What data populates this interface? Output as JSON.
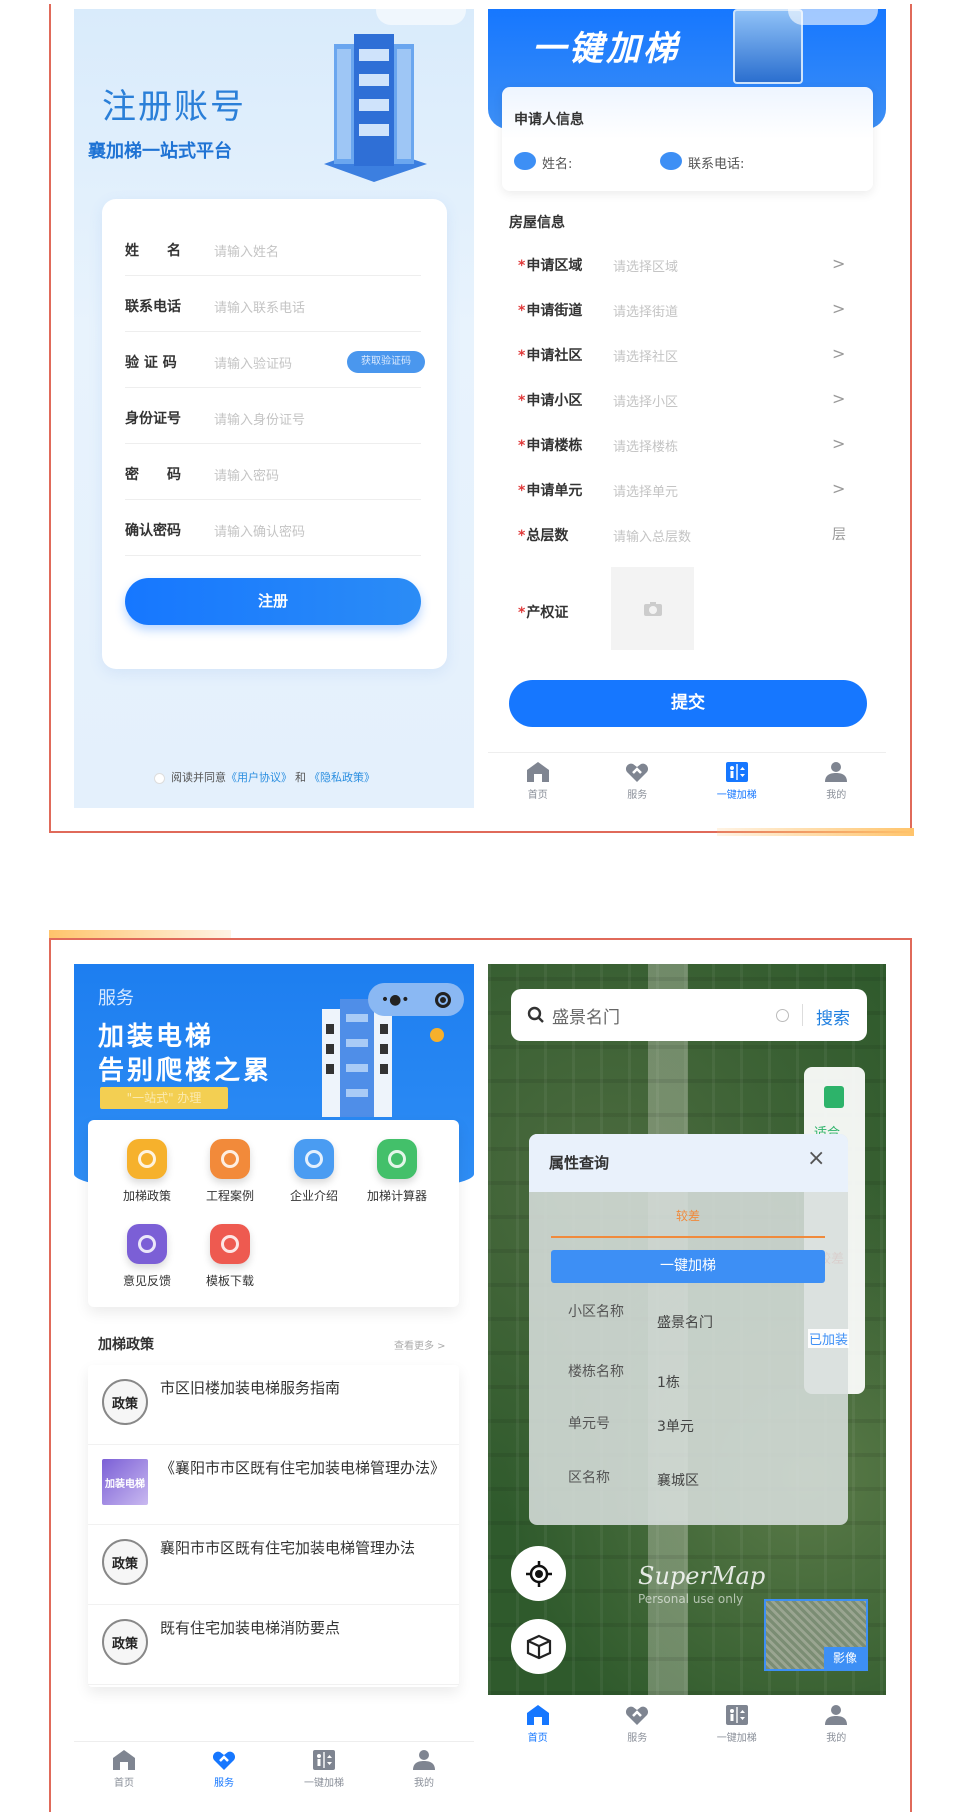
{
  "colors": {
    "accent": "#1677ff",
    "frame": "#e06a5a",
    "orange": "#f08a3c",
    "required": "#e03a3a"
  },
  "register": {
    "title": "注册账号",
    "subtitle": "襄加梯一站式平台",
    "fields": [
      {
        "label": "姓　　名",
        "placeholder": "请输入姓名"
      },
      {
        "label": "联系电话",
        "placeholder": "请输入联系电话"
      },
      {
        "label": "验 证 码",
        "placeholder": "请输入验证码"
      },
      {
        "label": "身份证号",
        "placeholder": "请输入身份证号"
      },
      {
        "label": "密　　码",
        "placeholder": "请输入密码"
      },
      {
        "label": "确认密码",
        "placeholder": "请输入确认密码"
      }
    ],
    "get_code": "获取验证码",
    "submit": "注册",
    "agree_prefix": "阅读并同意",
    "user_agreement": "《用户协议》",
    "and": "和",
    "privacy": "《隐私政策》"
  },
  "apply": {
    "title": "一键加梯",
    "applicant_heading": "申请人信息",
    "name_label": "姓名:",
    "phone_label": "联系电话:",
    "house_heading": "房屋信息",
    "rows": [
      {
        "label": "申请区域",
        "placeholder": "请选择区域",
        "suffix": ">"
      },
      {
        "label": "申请街道",
        "placeholder": "请选择街道",
        "suffix": ">"
      },
      {
        "label": "申请社区",
        "placeholder": "请选择社区",
        "suffix": ">"
      },
      {
        "label": "申请小区",
        "placeholder": "请选择小区",
        "suffix": ">"
      },
      {
        "label": "申请楼栋",
        "placeholder": "请选择楼栋",
        "suffix": ">"
      },
      {
        "label": "申请单元",
        "placeholder": "请选择单元",
        "suffix": ">"
      },
      {
        "label": "总层数",
        "placeholder": "请输入总层数",
        "suffix": "层"
      }
    ],
    "certificate_label": "产权证",
    "submit": "提交",
    "active_tab": 2
  },
  "nav": [
    "首页",
    "服务",
    "一键加梯",
    "我的"
  ],
  "service": {
    "tag": "服务",
    "headline1": "加装电梯",
    "headline2": "告别爬楼之累",
    "badge": "\"一站式\" 办理",
    "grid": [
      {
        "label": "加梯政策",
        "color": "#f6b12c"
      },
      {
        "label": "工程案例",
        "color": "#f28a3a"
      },
      {
        "label": "企业介绍",
        "color": "#4a9cf2"
      },
      {
        "label": "加梯计算器",
        "color": "#43c06a"
      },
      {
        "label": "意见反馈",
        "color": "#7b5fd6"
      },
      {
        "label": "模板下载",
        "color": "#ee5a50"
      }
    ],
    "policy_heading": "加梯政策",
    "more": "查看更多 >",
    "policies": [
      {
        "title": "市区旧楼加装电梯服务指南",
        "thumb": "政策"
      },
      {
        "title": "《襄阳市市区既有住宅加装电梯管理办法》",
        "thumb": "加装电梯"
      },
      {
        "title": "襄阳市市区既有住宅加装电梯管理办法",
        "thumb": "政策"
      },
      {
        "title": "既有住宅加装电梯消防要点",
        "thumb": "政策"
      }
    ],
    "active_tab": 1
  },
  "map": {
    "search_value": "盛景名门",
    "search_btn": "搜索",
    "side_items": [
      "适合",
      "较差",
      "已加装"
    ],
    "popup_title": "属性查询",
    "rating": "较差",
    "action": "一键加梯",
    "props": [
      {
        "label": "小区名称",
        "value": "盛景名门"
      },
      {
        "label": "楼栋名称",
        "value": "1栋"
      },
      {
        "label": "单元号",
        "value": "3单元"
      },
      {
        "label": "区名称",
        "value": "襄城区"
      }
    ],
    "watermark": "SuperMap",
    "watermark_sub": "Personal use only",
    "layer_label": "影像",
    "active_tab": 0
  }
}
